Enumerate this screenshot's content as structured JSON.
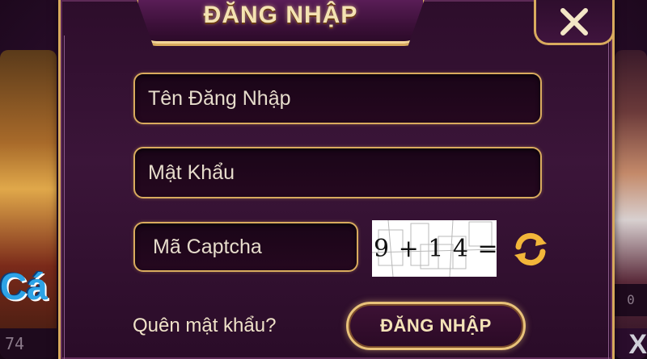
{
  "dialog": {
    "title": "ĐĂNG NHẬP",
    "close_icon": "close-icon"
  },
  "form": {
    "username_placeholder": "Tên Đăng Nhập",
    "password_placeholder": "Mật Khẩu",
    "captcha_placeholder": "Mã Captcha",
    "captcha_text": "9 + 1 4 = ?",
    "refresh_icon": "refresh-icon",
    "forgot_password": "Quên mật khẩu?",
    "submit_label": "ĐĂNG NHẬP"
  },
  "background": {
    "left_tile_text": "Cá",
    "left_tile_number": "74",
    "right_tile_number": "0",
    "right_tile_glyph": "X"
  },
  "colors": {
    "accent_gold": "#d9ab5e",
    "panel": "#2d0d2b",
    "refresh_gold": "#f2b63a"
  }
}
